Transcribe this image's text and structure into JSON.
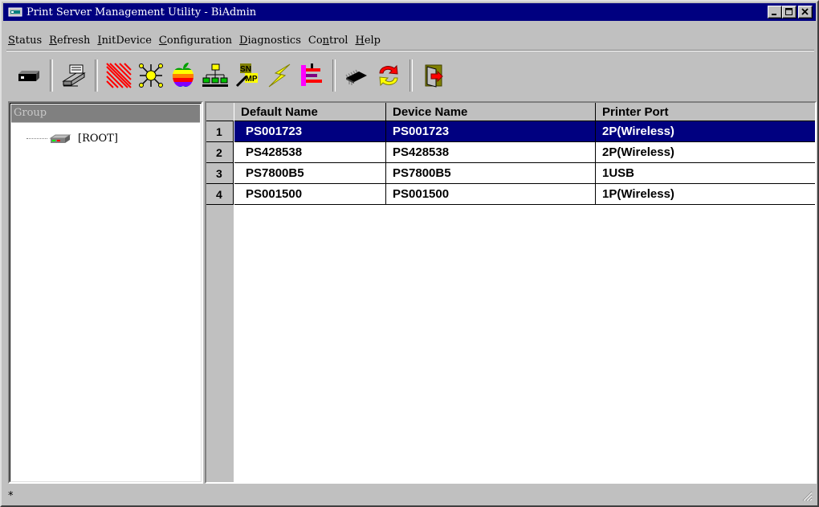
{
  "window": {
    "title": "Print Server Management Utility - BiAdmin",
    "min_label": "_",
    "max_label": "□",
    "close_label": "✕"
  },
  "menu": [
    {
      "accel": "S",
      "rest": "tatus"
    },
    {
      "accel": "R",
      "rest": "efresh"
    },
    {
      "accel": "I",
      "rest": "nitDevice"
    },
    {
      "accel": "C",
      "rest": "onfiguration"
    },
    {
      "accel": "D",
      "rest": "iagnostics"
    },
    {
      "pre": "Co",
      "accel": "n",
      "rest": "trol"
    },
    {
      "accel": "H",
      "rest": "elp"
    }
  ],
  "toolbar": {
    "icons": [
      "print-server-icon",
      "printer-icon",
      "red-stripes-icon",
      "network-burst-icon",
      "apple-icon",
      "netware-tree-icon",
      "snmp-icon",
      "lightning-icon",
      "network-ports-icon",
      "chip-icon",
      "refresh-arrows-icon",
      "exit-door-icon"
    ]
  },
  "left_pane": {
    "header": "Group",
    "tree_root": "[ROOT]"
  },
  "grid": {
    "columns": [
      "Default Name",
      "Device Name",
      "Printer Port"
    ],
    "rows": [
      {
        "num": "1",
        "default_name": "PS001723",
        "device_name": "PS001723",
        "printer_port": "2P(Wireless)",
        "selected": true
      },
      {
        "num": "2",
        "default_name": "PS428538",
        "device_name": "PS428538",
        "printer_port": "2P(Wireless)",
        "selected": false
      },
      {
        "num": "3",
        "default_name": "PS7800B5",
        "device_name": "PS7800B5",
        "printer_port": "1USB",
        "selected": false
      },
      {
        "num": "4",
        "default_name": "PS001500",
        "device_name": "PS001500",
        "printer_port": "1P(Wireless)",
        "selected": false
      }
    ]
  },
  "status": {
    "text": "*"
  },
  "colors": {
    "titlebar": "#000080",
    "selection": "#000080",
    "face": "#c0c0c0"
  }
}
